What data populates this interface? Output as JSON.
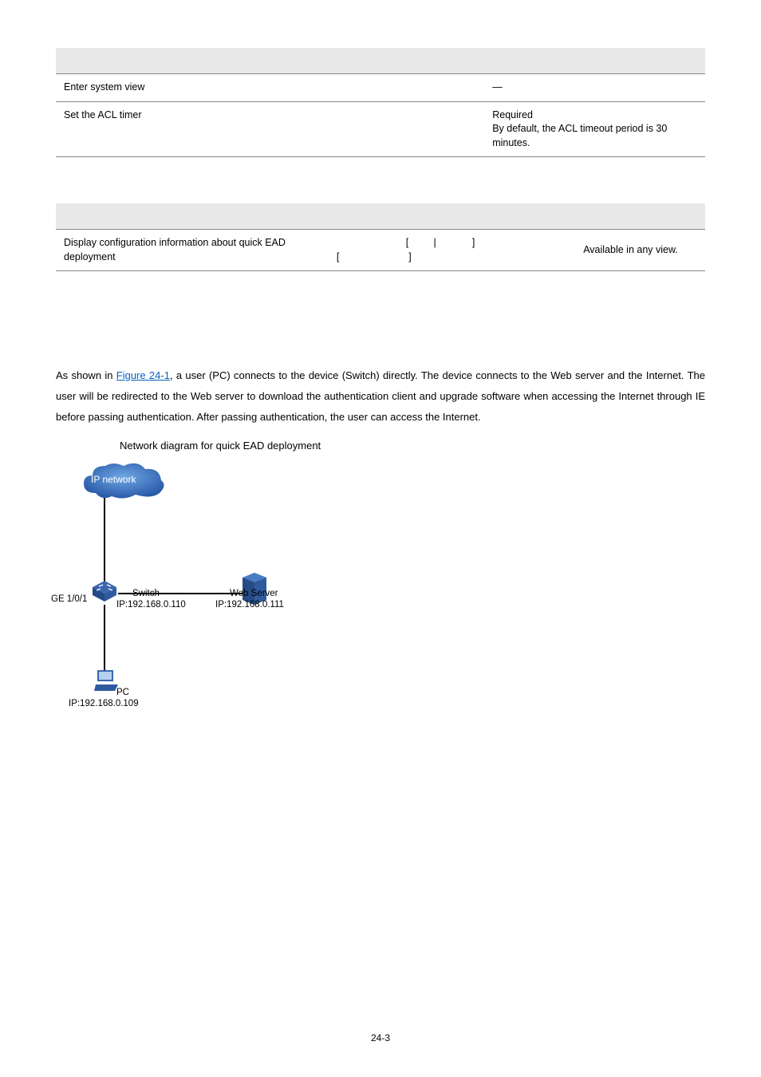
{
  "table1": {
    "rows": [
      {
        "todo": "Enter system view",
        "cmd": "",
        "desc": "—"
      },
      {
        "todo": "Set the ACL timer",
        "cmd": "",
        "desc": "Required\nBy default, the ACL timeout period is 30 minutes."
      }
    ]
  },
  "table2": {
    "rows": [
      {
        "todo": "Display configuration information about quick EAD deployment",
        "cmd_open1": "[",
        "cmd_bar": "|",
        "cmd_close1": "]",
        "cmd_open2": "[",
        "cmd_close2": "]",
        "desc": "Available in any view."
      }
    ]
  },
  "body": {
    "para_prefix": "As shown in ",
    "para_link": "Figure 24-1",
    "para_suffix": ", a user (PC) connects to the device (Switch) directly. The device connects to the Web server and the Internet. The user will be redirected to the Web server to download the authentication client and upgrade software when accessing the Internet through IE before passing authentication. After passing authentication, the user can access the Internet."
  },
  "figure": {
    "caption": "Network diagram for quick EAD deployment",
    "cloud": "IP network",
    "port": "GE 1/0/1",
    "switch_name": "Switch",
    "switch_ip": "IP:192.168.0.110",
    "server_name": "Web Server",
    "server_ip": "IP:192.168.0.111",
    "pc_name": "PC",
    "pc_ip": "IP:192.168.0.109"
  },
  "footer": "24-3"
}
